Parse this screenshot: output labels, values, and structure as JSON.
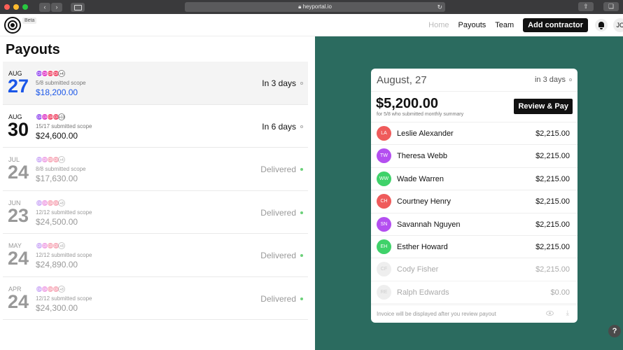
{
  "browser": {
    "url": "heyportal.io",
    "lights": [
      "#ff5f57",
      "#febc2e",
      "#28c840"
    ]
  },
  "header": {
    "beta": "Beta",
    "nav": [
      {
        "label": "Home",
        "muted": true
      },
      {
        "label": "Payouts",
        "muted": false
      },
      {
        "label": "Team",
        "muted": false
      }
    ],
    "add_label": "Add contractor",
    "user_initials": "JC"
  },
  "left": {
    "title": "Payouts",
    "rows": [
      {
        "month": "AUG",
        "day": "27",
        "scope": "5/8 submitted scope",
        "amount": "$18,200.00",
        "status": "In 3 days",
        "state": "pending",
        "selected": true,
        "blue": true,
        "avatars": [
          "CF",
          "CF",
          "CF",
          "CF"
        ],
        "more": "+4"
      },
      {
        "month": "AUG",
        "day": "30",
        "scope": "15/17 submitted scope",
        "amount": "$24,600.00",
        "status": "In 6 days",
        "state": "pending",
        "selected": false,
        "blue": false,
        "avatars": [
          "CF",
          "CF",
          "CF",
          "CF"
        ],
        "more": "+13"
      },
      {
        "month": "JUL",
        "day": "24",
        "scope": "8/8 submitted scope",
        "amount": "$17,630.00",
        "status": "Delivered",
        "state": "done",
        "selected": false,
        "blue": false,
        "avatars": [
          "CF",
          "CF",
          "CF",
          "CF"
        ],
        "more": "+4"
      },
      {
        "month": "JUN",
        "day": "23",
        "scope": "12/12 submitted scope",
        "amount": "$24,500.00",
        "status": "Delivered",
        "state": "done",
        "selected": false,
        "blue": false,
        "avatars": [
          "CF",
          "CF",
          "CF",
          "CF"
        ],
        "more": "+8"
      },
      {
        "month": "MAY",
        "day": "24",
        "scope": "12/12 submitted scope",
        "amount": "$24,890.00",
        "status": "Delivered",
        "state": "done",
        "selected": false,
        "blue": false,
        "avatars": [
          "CF",
          "CF",
          "CF",
          "CF"
        ],
        "more": "+8"
      },
      {
        "month": "APR",
        "day": "24",
        "scope": "12/12 submitted scope",
        "amount": "$24,300.00",
        "status": "Delivered",
        "state": "done",
        "selected": false,
        "blue": false,
        "avatars": [
          "CF",
          "CF",
          "CF",
          "CF"
        ],
        "more": "+8"
      }
    ],
    "avatar_colors": [
      "#9b59f0",
      "#e040c8",
      "#f0506e",
      "#f0506e"
    ]
  },
  "card": {
    "date": "August, 27",
    "when": "in 3 days",
    "total": "$5,200.00",
    "subtitle": "for 5/8 who submitted monthly summary",
    "review_label": "Review & Pay",
    "people": [
      {
        "initials": "LA",
        "name": "Leslie Alexander",
        "amount": "$2,215.00",
        "color": "#ef5b5b",
        "active": true
      },
      {
        "initials": "TW",
        "name": "Theresa Webb",
        "amount": "$2,215.00",
        "color": "#b44ff0",
        "active": true
      },
      {
        "initials": "WW",
        "name": "Wade Warren",
        "amount": "$2,215.00",
        "color": "#3fd26a",
        "active": true
      },
      {
        "initials": "CH",
        "name": "Courtney Henry",
        "amount": "$2,215.00",
        "color": "#ef5b5b",
        "active": true
      },
      {
        "initials": "SN",
        "name": "Savannah Nguyen",
        "amount": "$2,215.00",
        "color": "#b44ff0",
        "active": true
      },
      {
        "initials": "EH",
        "name": "Esther Howard",
        "amount": "$2,215.00",
        "color": "#3fd26a",
        "active": true
      },
      {
        "initials": "CF",
        "name": "Cody Fisher",
        "amount": "$2,215.00",
        "color": "#eeeeee",
        "active": false
      },
      {
        "initials": "RE",
        "name": "Ralph Edwards",
        "amount": "$0.00",
        "color": "#eeeeee",
        "active": false
      }
    ],
    "footer": "Invoice will be displayed after you review payout"
  },
  "help_label": "?"
}
